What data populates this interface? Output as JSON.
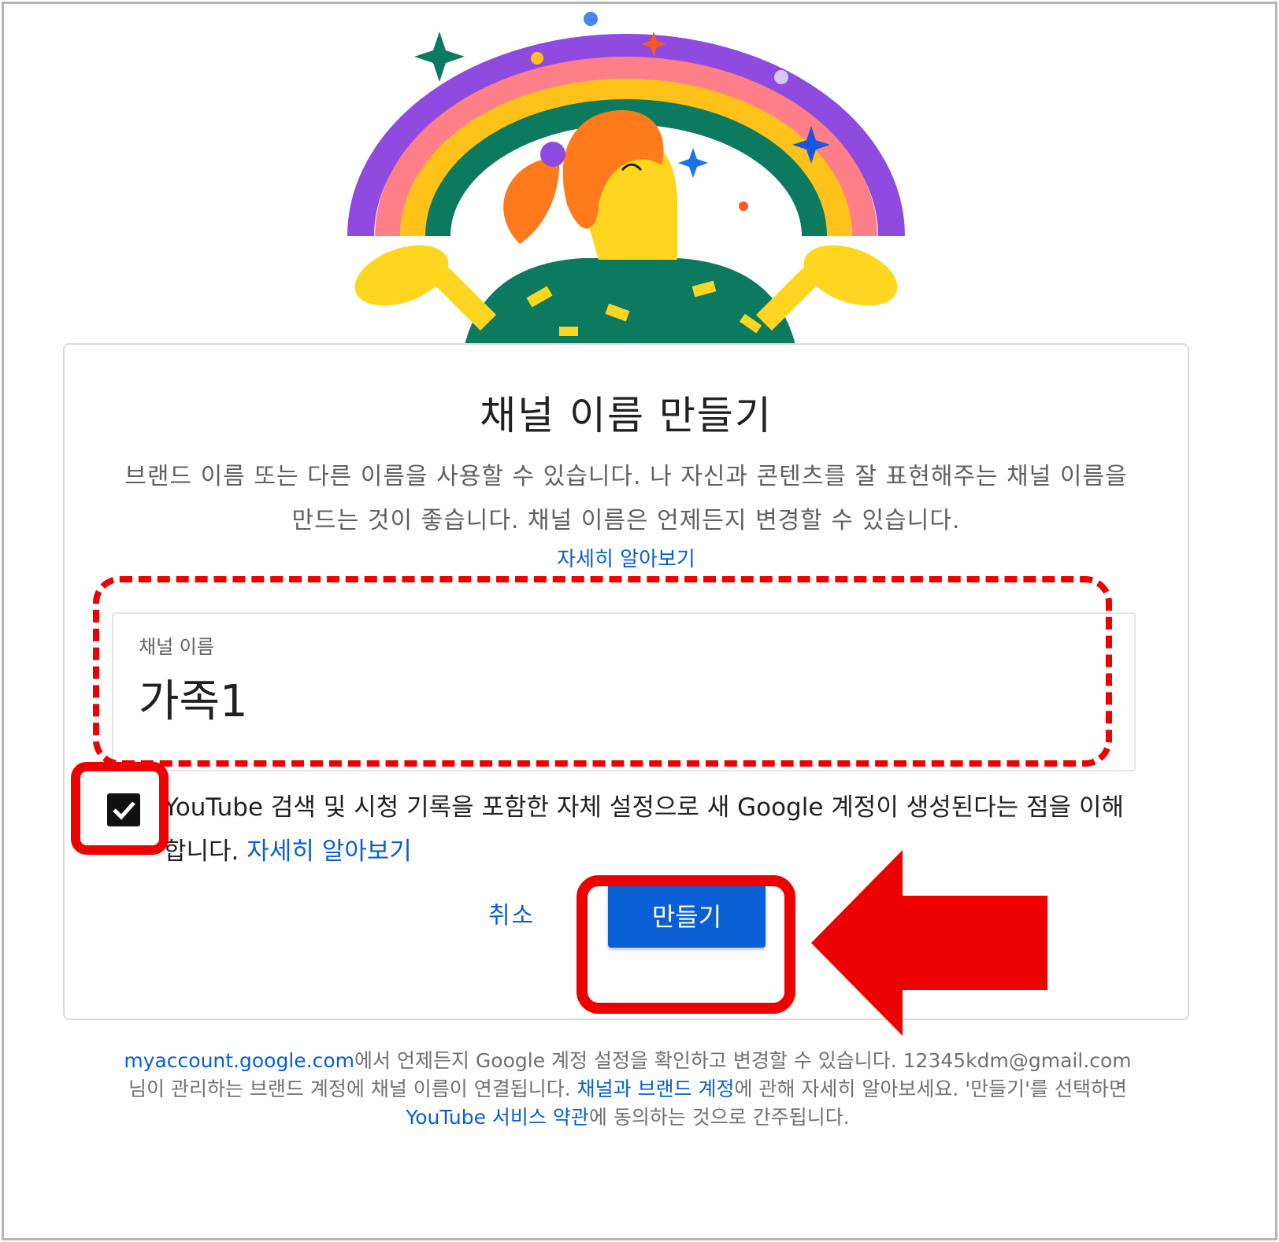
{
  "dialog": {
    "title": "채널 이름 만들기",
    "description": "브랜드 이름 또는 다른 이름을 사용할 수 있습니다. 나 자신과 콘텐츠를 잘 표현해주는 채널 이름을 만드는 것이 좋습니다. 채널 이름은 언제든지 변경할 수 있습니다.",
    "learn_more": "자세히 알아보기"
  },
  "channel_field": {
    "label": "채널 이름",
    "value": "가족1"
  },
  "consent": {
    "checked": true,
    "text": "YouTube 검색 및 시청 기록을 포함한 자체 설정으로 새 Google 계정이 생성된다는 점을 이해합니다.",
    "link": "자세히 알아보기"
  },
  "actions": {
    "cancel": "취소",
    "create": "만들기"
  },
  "footer": {
    "account_link": "myaccount.google.com",
    "text1": "에서 언제든지 Google 계정 설정을 확인하고 변경할 수 있습니다.",
    "email": "12345kdm@gmail.com",
    "text2": "님이 관리하는 브랜드 계정에 채널 이름이 연결됩니다.",
    "brand_link": "채널과 브랜드 계정",
    "text3": "에 관해 자세히 알아보세요. '만들기'를 선택하면",
    "terms_link": "YouTube 서비스 약관",
    "text4": "에 동의하는 것으로 간주됩니다."
  },
  "colors": {
    "link": "#065fd4",
    "primary_button": "#0b5fd4",
    "annotation": "#ee0000"
  },
  "icons": {
    "checkbox": "check-icon",
    "illustration": "rainbow-person-illustration"
  }
}
